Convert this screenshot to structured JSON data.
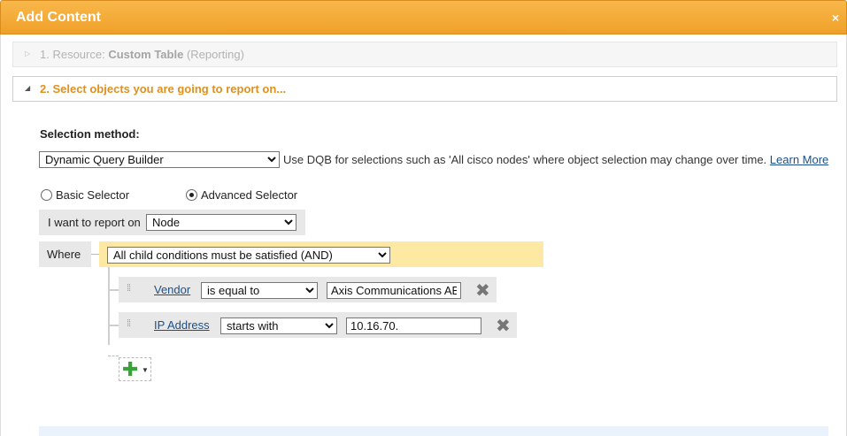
{
  "dialog": {
    "title": "Add Content",
    "close_glyph": "×"
  },
  "steps": {
    "step1": {
      "arrow": "▷",
      "prefix": "1. Resource: ",
      "bold": "Custom Table",
      "suffix": " (Reporting)"
    },
    "step2": {
      "arrow": "◢",
      "text": "2. Select objects you are going to report on..."
    }
  },
  "selection": {
    "label": "Selection method:",
    "method": "Dynamic Query Builder",
    "hint": "Use DQB for selections such as 'All cisco nodes' where object selection may change over time.",
    "learn_more": "Learn More"
  },
  "selector": {
    "basic": "Basic Selector",
    "advanced": "Advanced Selector",
    "selected": "advanced"
  },
  "report_on": {
    "label": "I want to report on",
    "value": "Node"
  },
  "where": {
    "label": "Where",
    "group": "All child conditions must be satisfied (AND)",
    "conditions": [
      {
        "field": "Vendor",
        "operator": "is equal to",
        "value": "Axis Communications AB"
      },
      {
        "field": "IP Address",
        "operator": "starts with",
        "value": "10.16.70."
      }
    ]
  },
  "icons": {
    "grip": "drag-handle-icon",
    "delete": "close-x-icon",
    "add": "green-plus-icon"
  },
  "colors": {
    "title_bar": "#f0a02a",
    "step_active_text": "#e0901c",
    "and_group_bg": "#fde8a4",
    "link": "#1a4f8a",
    "add_plus": "#3aa23a"
  }
}
